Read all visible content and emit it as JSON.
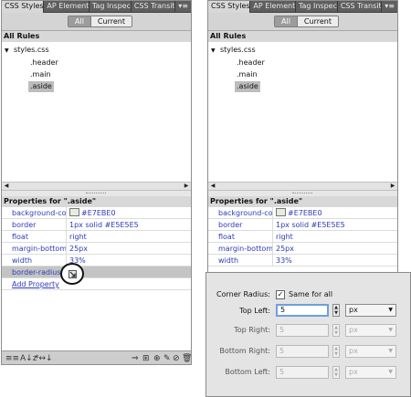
{
  "tabs": [
    "CSS Styles",
    "AP Element",
    "Tag Inspec",
    "CSS Transit"
  ],
  "tab_menu": "▾≡",
  "toggle": {
    "all": "All",
    "current": "Current"
  },
  "all_rules_label": "All Rules",
  "tree": {
    "root": "styles.css",
    "children": [
      ".header",
      ".main",
      ".aside"
    ]
  },
  "properties_label": "Properties for \".aside\"",
  "properties": [
    {
      "name": "background-co...",
      "value": "#E7EBE0"
    },
    {
      "name": "border",
      "value": "1px solid #E5E5E5"
    },
    {
      "name": "float",
      "value": "right"
    },
    {
      "name": "margin-bottom",
      "value": "25px"
    },
    {
      "name": "width",
      "value": "33%"
    },
    {
      "name": "border-radius",
      "value": ""
    }
  ],
  "add_property": "Add Property",
  "right_partial_value": "33%",
  "bottom_icons": [
    "≡≡",
    "A↓z",
    "*↔↓",
    "⇒",
    "⊞",
    "⊕",
    "✎",
    "⊘",
    "🗑"
  ],
  "dialog": {
    "corner_radius_label": "Corner Radius:",
    "same_for_all_label": "Same for all",
    "same_for_all_checked": true,
    "rows": [
      {
        "label": "Top Left:",
        "value": "5",
        "unit": "px",
        "enabled": true
      },
      {
        "label": "Top Right:",
        "value": "5",
        "unit": "px",
        "enabled": false
      },
      {
        "label": "Bottom Right:",
        "value": "5",
        "unit": "px",
        "enabled": false
      },
      {
        "label": "Bottom Left:",
        "value": "5",
        "unit": "px",
        "enabled": false
      }
    ]
  },
  "colors": {
    "swatch": "#E7EBE0",
    "link": "#2E3BB8",
    "tabbar": "#5F5F5F"
  }
}
